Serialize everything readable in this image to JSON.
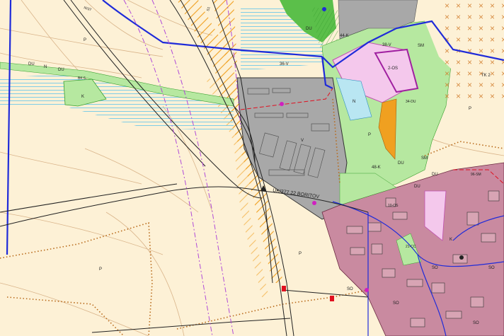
{
  "colors": {
    "background": "#fdf1d6",
    "agricultural": "#fdf1d6",
    "industrial": "#a8a8a8",
    "residential": "#c98aa0",
    "green_meadow": "#b6e8a0",
    "green_forest": "#5bbf4a",
    "pink_zone": "#f4c8ec",
    "cyan_zone": "#b9e6f2",
    "orange_zone": "#f0a020",
    "boundary_blue": "#1f2bd9",
    "road": "#ffffff",
    "hatch_orange": "#f0a020",
    "dotted_brown": "#b86a1a",
    "purple_dashed": "#b04ad8",
    "red_dashed": "#e01020"
  },
  "labels": {
    "road_label": "ÚK/377 22 BORITOV",
    "road_top_a": "S1",
    "road_top_b": "III/37",
    "zone_du_1": "DU",
    "zone_n_1": "N",
    "zone_du_2": "DU",
    "zone_k_1": "K",
    "zone_p_1": "P",
    "zone_p_2": "P",
    "zone_p_3": "P",
    "zone_p_4": "P",
    "zone_p_5": "P",
    "zone_36v": "36-V",
    "zone_38v": "38-V",
    "zone_2os": "2-OS",
    "zone_44k": "44-K",
    "zone_sm_1": "SM",
    "zone_sm_2": "SM",
    "zone_tk2": "TK 2",
    "zone_34du": "34-DU",
    "zone_48k": "48-K",
    "zone_du_3": "DU",
    "zone_du_4": "DU",
    "zone_du_5": "DU",
    "zone_du_6": "DU",
    "zone_v_1": "V",
    "zone_n_2": "N",
    "zone_21cc": "21-CC",
    "zone_so_1": "SO",
    "zone_so_2": "SO",
    "zone_so_3": "SO",
    "zone_so_4": "SO",
    "zone_so_5": "SO",
    "zone_bk6": "BK 6",
    "zone_ks": "K",
    "zone_96sm": "96-SM",
    "zone_10os": "10-OS"
  }
}
